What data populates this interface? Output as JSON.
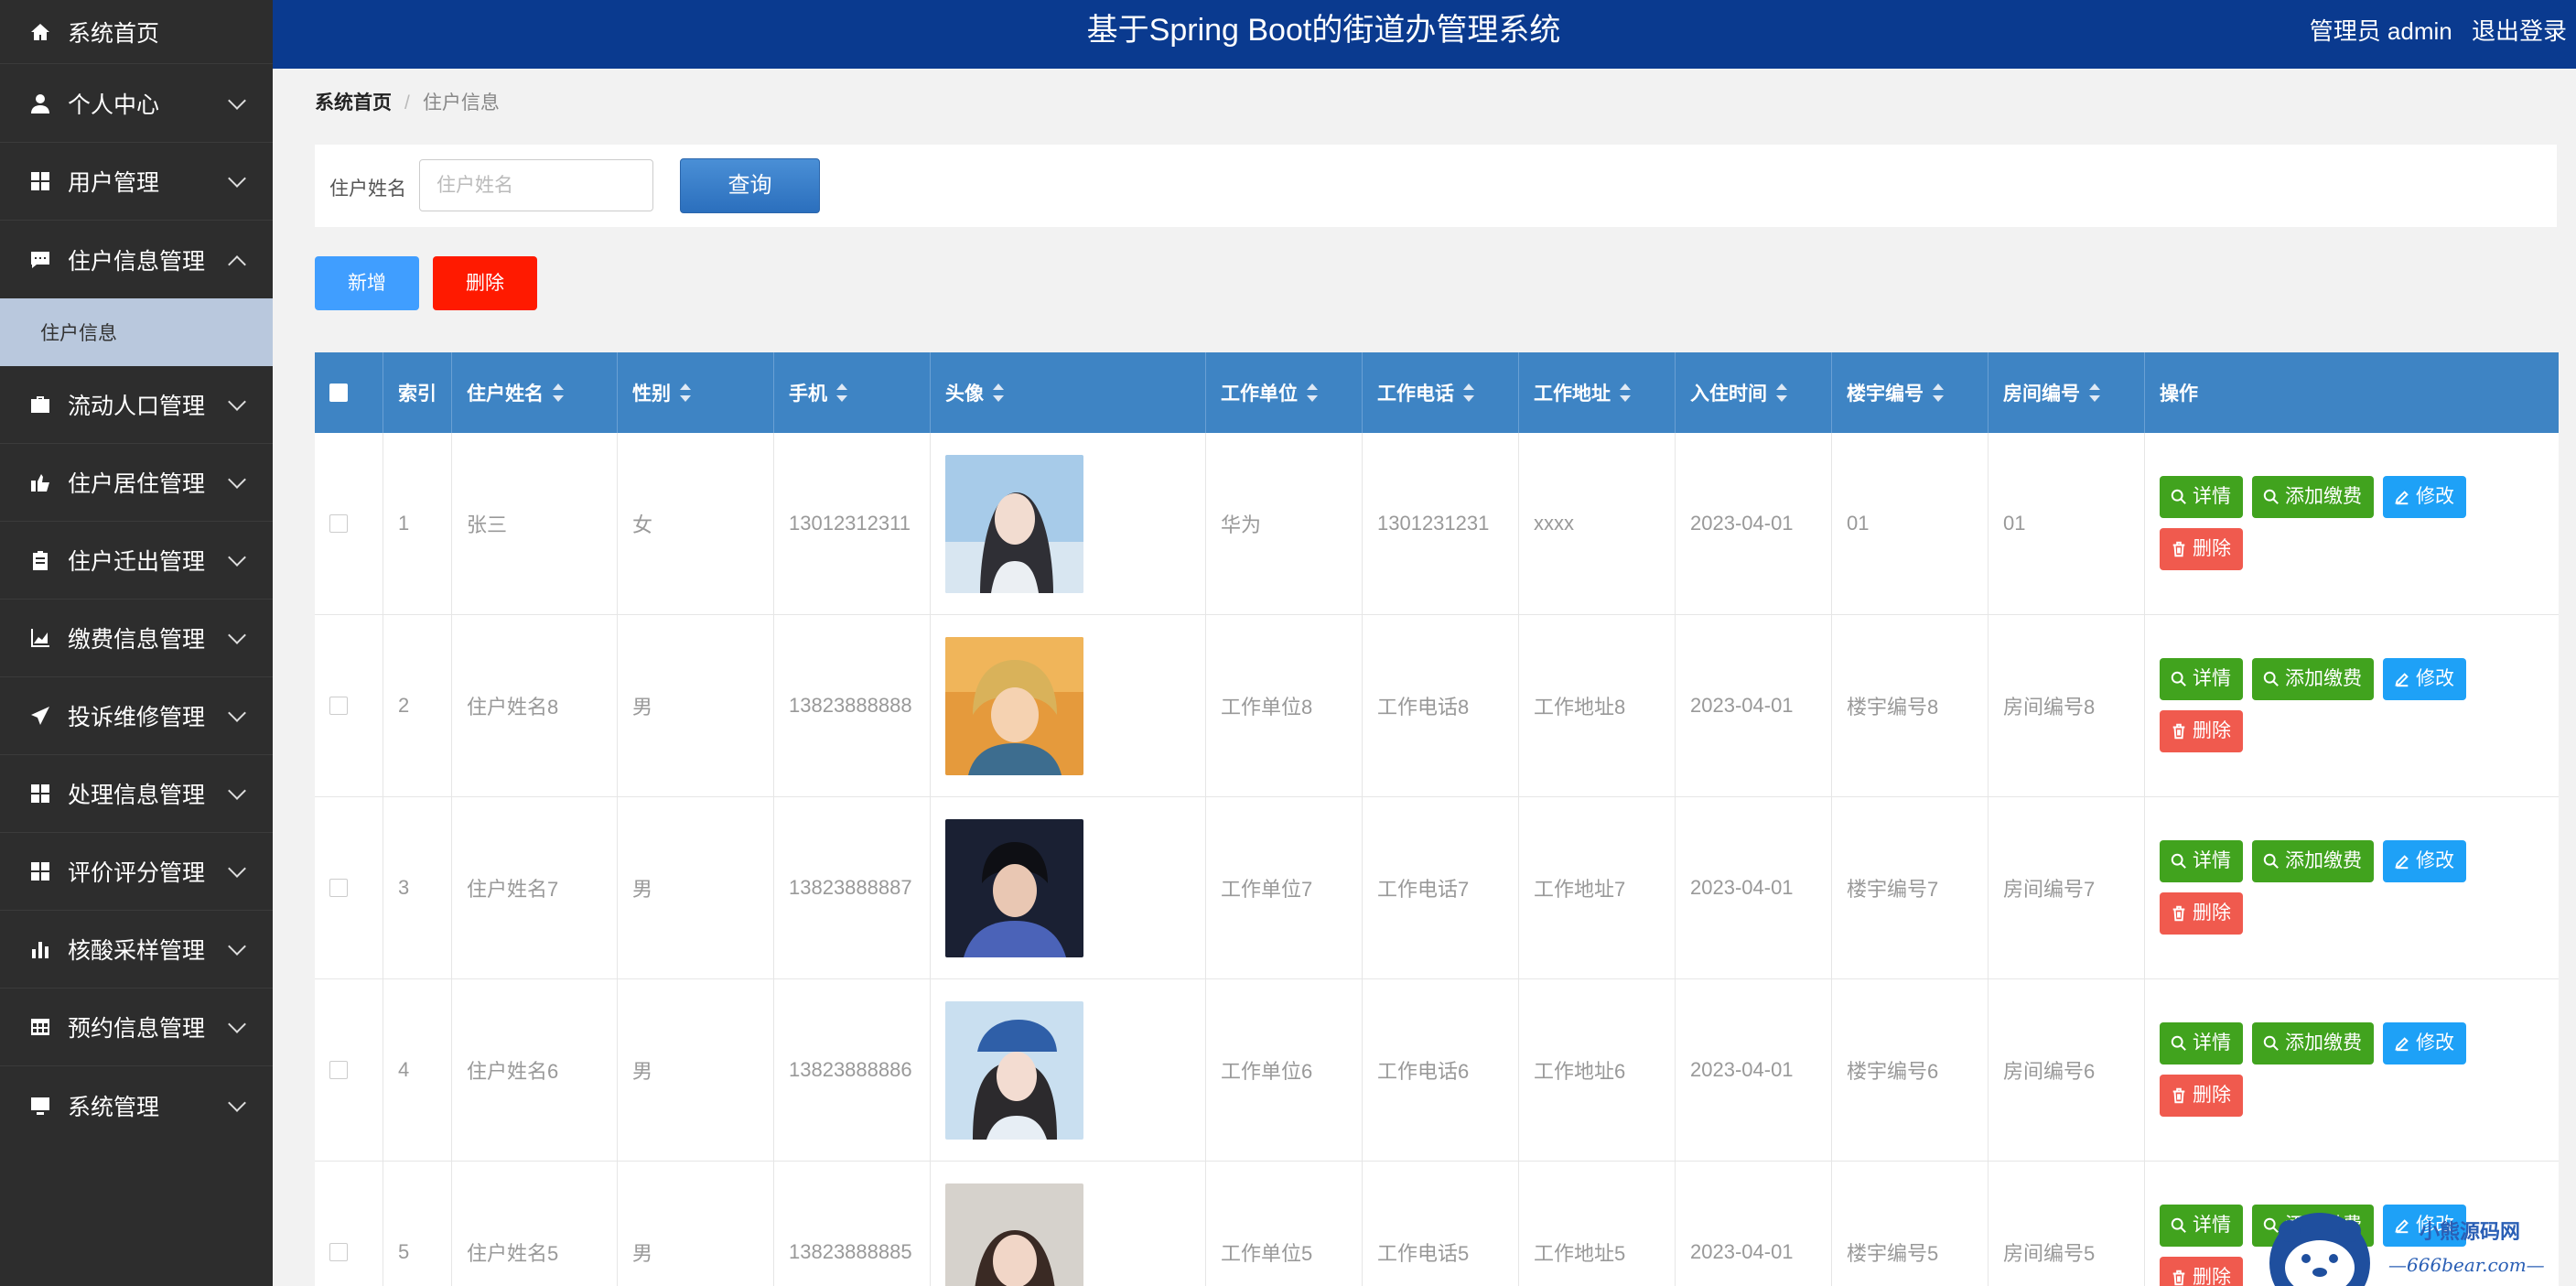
{
  "header": {
    "title": "基于Spring Boot的街道办管理系统",
    "user_label": "管理员 admin",
    "logout_label": "退出登录"
  },
  "sidebar": {
    "items": [
      {
        "label": "系统首页",
        "icon": "home-icon"
      },
      {
        "label": "个人中心",
        "icon": "user-icon"
      },
      {
        "label": "用户管理",
        "icon": "grid-icon"
      },
      {
        "label": "住户信息管理",
        "icon": "chat-icon",
        "expanded": true,
        "children": [
          {
            "label": "住户信息"
          }
        ]
      },
      {
        "label": "流动人口管理",
        "icon": "briefcase-icon"
      },
      {
        "label": "住户居住管理",
        "icon": "thumbs-up-icon"
      },
      {
        "label": "住户迁出管理",
        "icon": "clipboard-icon"
      },
      {
        "label": "缴费信息管理",
        "icon": "area-chart-icon"
      },
      {
        "label": "投诉维修管理",
        "icon": "send-icon"
      },
      {
        "label": "处理信息管理",
        "icon": "grid-icon"
      },
      {
        "label": "评价评分管理",
        "icon": "grid-icon"
      },
      {
        "label": "核酸采样管理",
        "icon": "bar-chart-icon"
      },
      {
        "label": "预约信息管理",
        "icon": "table-icon"
      },
      {
        "label": "系统管理",
        "icon": "monitor-icon"
      }
    ]
  },
  "breadcrumb": {
    "home": "系统首页",
    "separator": "/",
    "current": "住户信息"
  },
  "search": {
    "label": "住户姓名",
    "placeholder": "住户姓名",
    "value": "",
    "button_label": "查询"
  },
  "actions": {
    "add_label": "新增",
    "delete_label": "删除"
  },
  "table": {
    "columns": [
      "索引",
      "住户姓名",
      "性别",
      "手机",
      "头像",
      "工作单位",
      "工作电话",
      "工作地址",
      "入住时间",
      "楼宇编号",
      "房间编号",
      "操作"
    ],
    "rows": [
      {
        "index": "1",
        "name": "张三",
        "gender": "女",
        "phone": "13012312311",
        "work_unit": "华为",
        "work_phone": "1301231231",
        "work_addr": "xxxx",
        "checkin": "2023-04-01",
        "building": "01",
        "room": "01"
      },
      {
        "index": "2",
        "name": "住户姓名8",
        "gender": "男",
        "phone": "13823888888",
        "work_unit": "工作单位8",
        "work_phone": "工作电话8",
        "work_addr": "工作地址8",
        "checkin": "2023-04-01",
        "building": "楼宇编号8",
        "room": "房间编号8"
      },
      {
        "index": "3",
        "name": "住户姓名7",
        "gender": "男",
        "phone": "13823888887",
        "work_unit": "工作单位7",
        "work_phone": "工作电话7",
        "work_addr": "工作地址7",
        "checkin": "2023-04-01",
        "building": "楼宇编号7",
        "room": "房间编号7"
      },
      {
        "index": "4",
        "name": "住户姓名6",
        "gender": "男",
        "phone": "13823888886",
        "work_unit": "工作单位6",
        "work_phone": "工作电话6",
        "work_addr": "工作地址6",
        "checkin": "2023-04-01",
        "building": "楼宇编号6",
        "room": "房间编号6"
      },
      {
        "index": "5",
        "name": "住户姓名5",
        "gender": "男",
        "phone": "13823888885",
        "work_unit": "工作单位5",
        "work_phone": "工作电话5",
        "work_addr": "工作地址5",
        "checkin": "2023-04-01",
        "building": "楼宇编号5",
        "room": "房间编号5"
      }
    ],
    "row_actions": {
      "detail": "详情",
      "add_fee": "添加缴费",
      "edit": "修改",
      "delete": "删除"
    }
  },
  "watermark": {
    "line1": "小熊源码网",
    "line2": "—666bear.com—"
  },
  "colors": {
    "header_bg": "#0a3a8f",
    "sidebar_bg": "#2d2d2d",
    "submenu_active_bg": "#b9c8dd",
    "table_head_bg": "#3e84c4",
    "primary": "#409eff",
    "danger": "#ff1a00",
    "success": "#41a31e"
  }
}
